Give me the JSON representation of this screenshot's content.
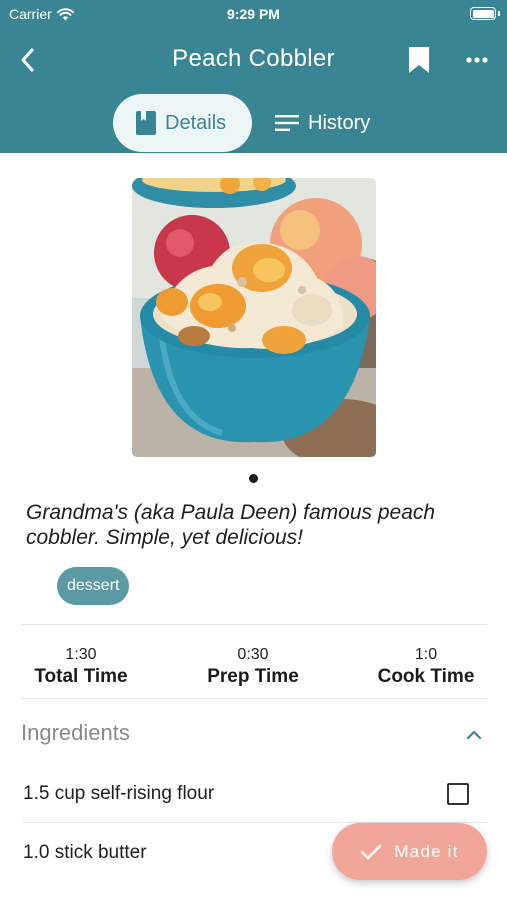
{
  "status_bar": {
    "carrier": "Carrier",
    "time": "9:29 PM",
    "battery_level": 1.0
  },
  "nav": {
    "title": "Peach Cobbler",
    "back_icon": "chevron-left-icon",
    "bookmark_icon": "bookmark-icon",
    "more_icon": "more-horizontal-icon"
  },
  "tabs": [
    {
      "label": "Details",
      "icon": "book-icon",
      "selected": true
    },
    {
      "label": "History",
      "icon": "list-icon",
      "selected": false
    }
  ],
  "photo": {
    "subject": "peach cobbler in a teal bowl",
    "page_count": 1,
    "current_page": 1
  },
  "description": "Grandma's (aka Paula Deen) famous peach cobbler. Simple, yet delicious!",
  "tags": [
    "dessert"
  ],
  "times": [
    {
      "value": "1:30",
      "label": "Total Time"
    },
    {
      "value": "0:30",
      "label": "Prep Time"
    },
    {
      "value": "1:0",
      "label": "Cook Time"
    }
  ],
  "ingredients": {
    "title": "Ingredients",
    "expanded": true,
    "items": [
      {
        "text": "1.5 cup self-rising flour",
        "checked": false
      },
      {
        "text": "1.0 stick butter",
        "checked": false
      }
    ]
  },
  "fab": {
    "label": "Made it",
    "icon": "check-icon"
  },
  "colors": {
    "header": "#3a8593",
    "accent": "#3a8593",
    "chip": "#5b9aa4",
    "fab": "#f1a699"
  }
}
